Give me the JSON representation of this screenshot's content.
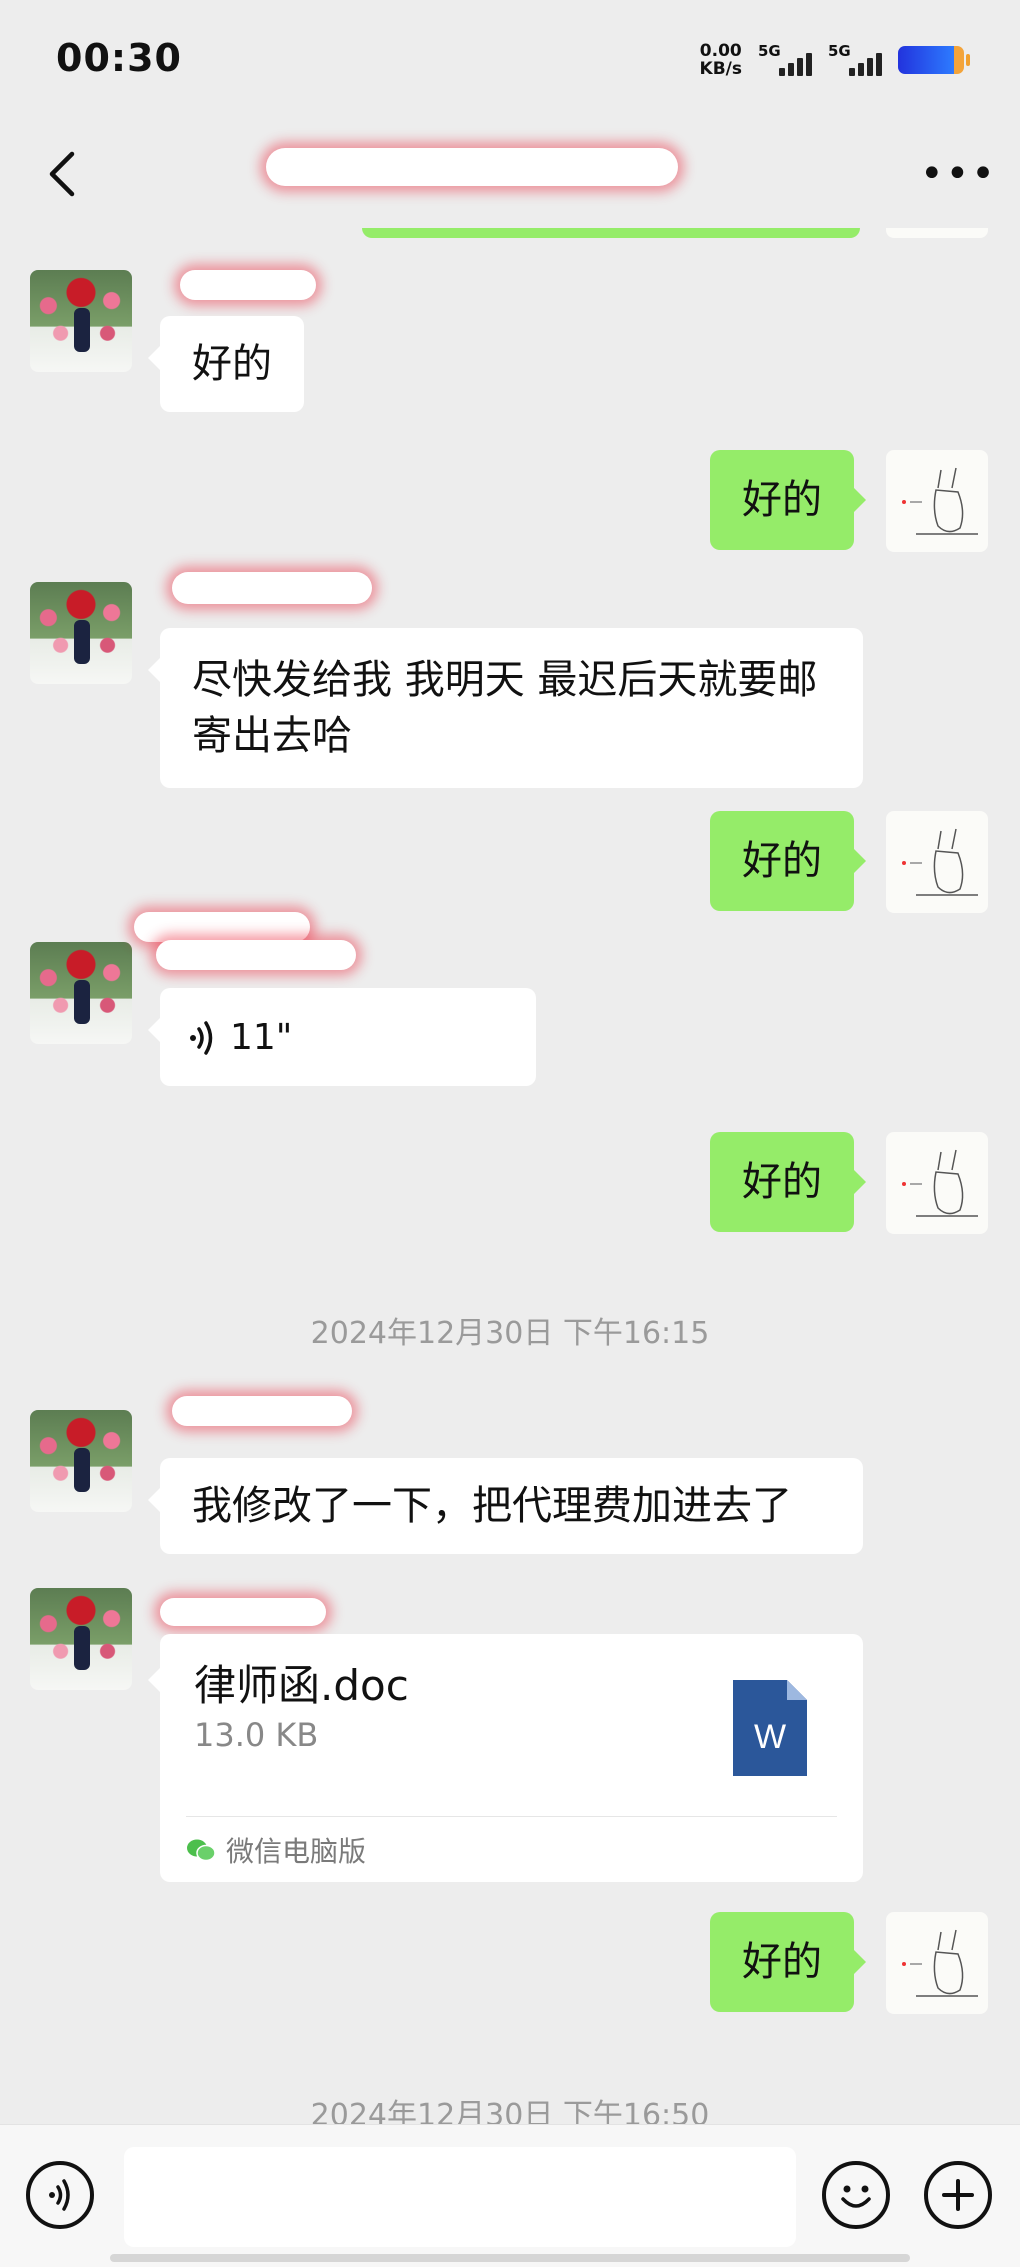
{
  "status_bar": {
    "time": "00:30",
    "net_speed_value": "0.00",
    "net_speed_unit": "KB/s",
    "signal_1_label": "5G",
    "signal_2_label": "5G",
    "battery_color": "#2d5bff"
  },
  "nav": {
    "back_icon": "chevron-left-icon",
    "more_icon": "ellipsis-icon",
    "more_label": "•••"
  },
  "messages": {
    "m1_text": "好的",
    "m2_text": "好的",
    "m3_text": "尽快发给我 我明天 最迟后天就要邮寄出去哈",
    "m4_text": "好的",
    "m5_duration": "11\"",
    "m6_text": "好的",
    "timestamp_1": "2024年12月30日 下午16:15",
    "m7_text": "我修改了一下，把代理费加进去了",
    "m8_file_name": "律师函.doc",
    "m8_file_size": "13.0 KB",
    "m8_file_source": "微信电脑版",
    "m8_file_icon_letter": "W",
    "m9_text": "好的",
    "timestamp_2": "2024年12月30日 下午16:50"
  },
  "colors": {
    "sent_bubble": "#95ec69",
    "received_bubble": "#ffffff",
    "background": "#ededed",
    "word_blue": "#2b579a"
  },
  "input_bar": {
    "voice_icon": "voice-icon",
    "emoji_icon": "emoji-icon",
    "plus_icon": "plus-icon",
    "placeholder": ""
  }
}
